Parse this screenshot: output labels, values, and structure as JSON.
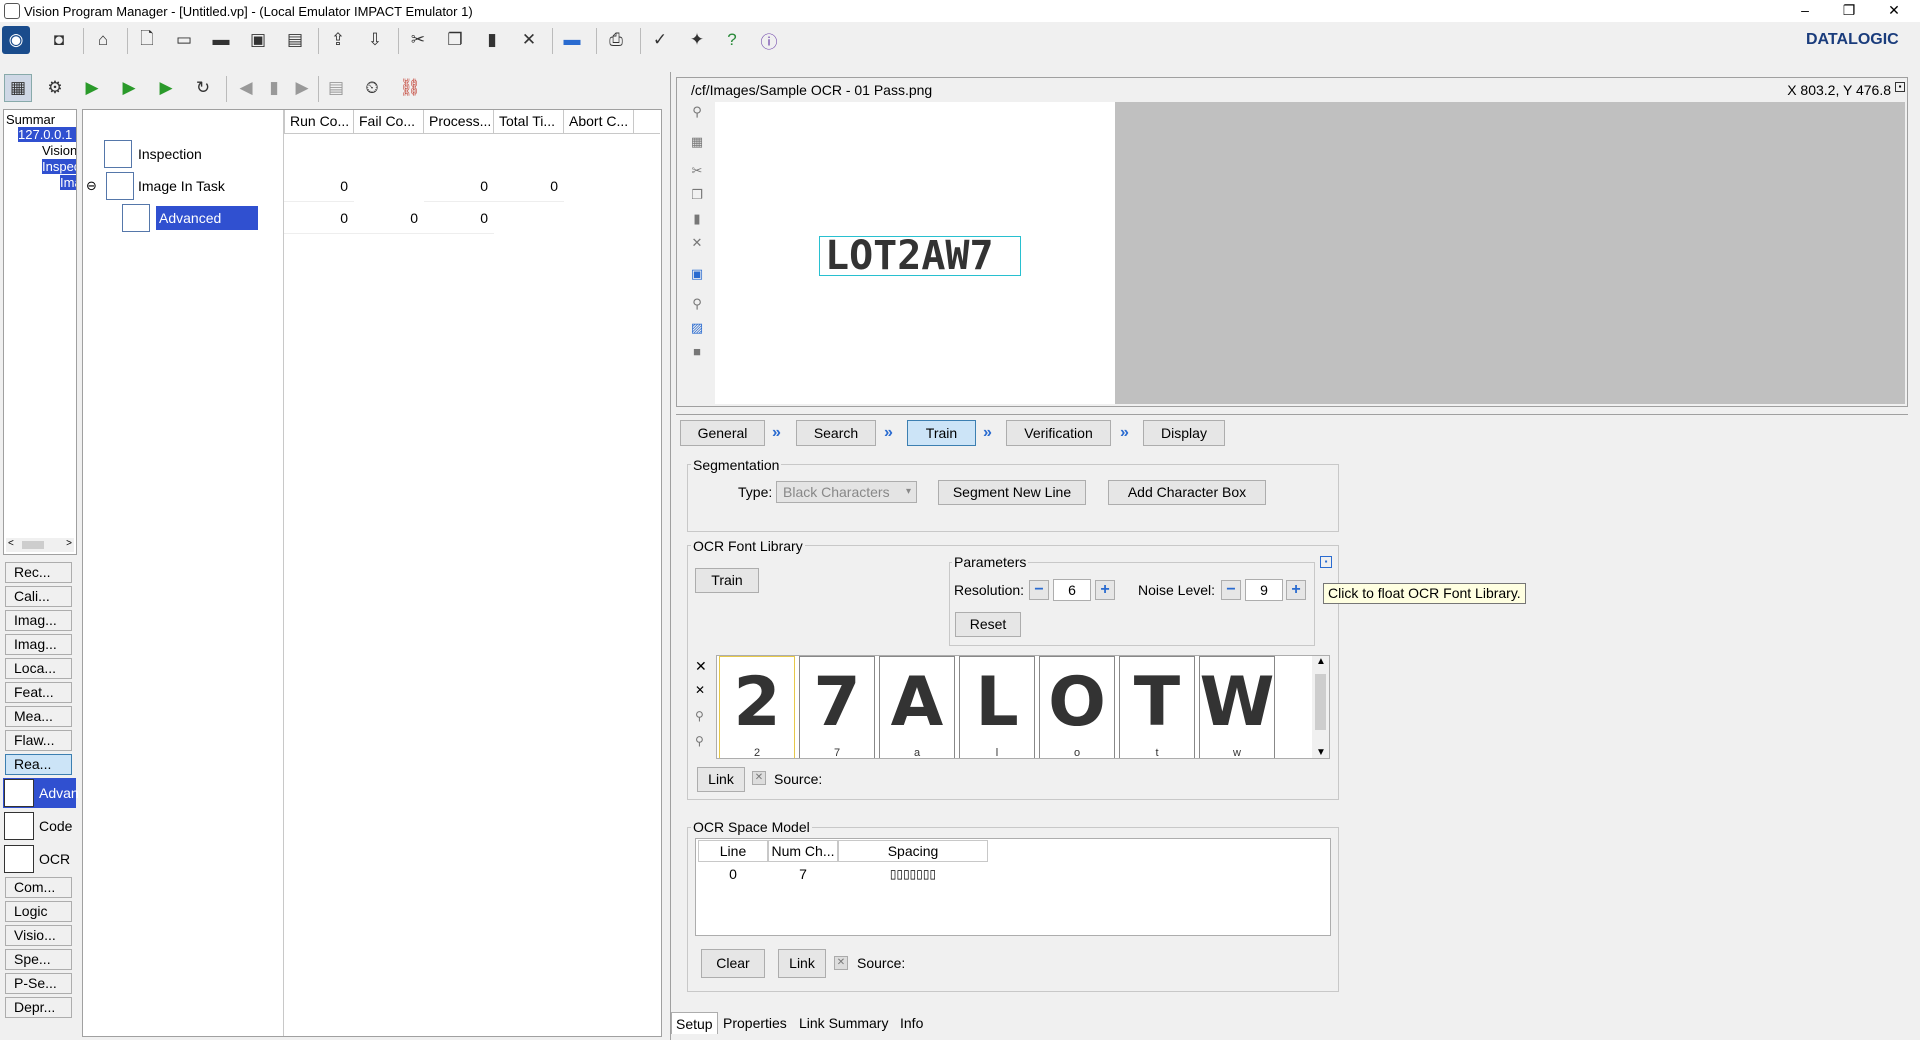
{
  "window": {
    "title": "Vision Program Manager - [Untitled.vp] - (Local Emulator IMPACT Emulator 1)",
    "minimize": "–",
    "restore": "❐",
    "close": "✕"
  },
  "brand": {
    "logo_text": "DATALOGIC"
  },
  "left_tree": {
    "items": [
      "Summar",
      "127.0.0.1",
      "Vision",
      "Inspec",
      "Ima"
    ]
  },
  "nav_buttons": [
    "Rec...",
    "Cali...",
    "Imag...",
    "Imag...",
    "Loca...",
    "Feat...",
    "Mea...",
    "Flaw...",
    "Rea..."
  ],
  "nav_big": [
    {
      "label": "Advan",
      "icon": "advanced-ocr-icon"
    },
    {
      "label": "Code",
      "icon": "code-reader-icon"
    },
    {
      "label": "OCR",
      "icon": "ocr-icon"
    }
  ],
  "nav_buttons2": [
    "Com...",
    "Logic",
    "Visio...",
    "Spe...",
    "P-Se...",
    "Depr..."
  ],
  "task_grid": {
    "columns": [
      "Run Co...",
      "Fail Co...",
      "Process...",
      "Total Ti...",
      "Abort C..."
    ],
    "rows": [
      {
        "name": "Inspection",
        "values": [
          "",
          "",
          "",
          "",
          ""
        ]
      },
      {
        "name": "Image In Task",
        "values": [
          "0",
          "",
          "0",
          "0",
          ""
        ]
      },
      {
        "name": "Advanced OCR",
        "values": [
          "0",
          "0",
          "0",
          "",
          ""
        ]
      }
    ]
  },
  "image_view": {
    "path": "/cf/Images/Sample OCR - 01 Pass.png",
    "coords": "X 803.2,  Y 476.8",
    "ocr_text": "LOT2AW7"
  },
  "steps": [
    "General",
    "Search",
    "Train",
    "Verification",
    "Display"
  ],
  "segmentation": {
    "title": "Segmentation",
    "type_label": "Type:",
    "type_value": "Black Characters",
    "segment_button": "Segment New Line",
    "add_box_button": "Add Character Box"
  },
  "font_library": {
    "title": "OCR Font Library",
    "train_button": "Train",
    "params_title": "Parameters",
    "resolution_label": "Resolution:",
    "resolution_value": "6",
    "noise_label": "Noise Level:",
    "noise_value": "9",
    "reset_button": "Reset",
    "tooltip": "Click to float OCR Font Library.",
    "glyphs": [
      {
        "char": "2",
        "label": "2"
      },
      {
        "char": "7",
        "label": "7"
      },
      {
        "char": "A",
        "label": "a"
      },
      {
        "char": "L",
        "label": "l"
      },
      {
        "char": "O",
        "label": "o"
      },
      {
        "char": "T",
        "label": "t"
      },
      {
        "char": "W",
        "label": "w"
      }
    ],
    "link_button": "Link",
    "source_label": "Source:"
  },
  "space_model": {
    "title": "OCR Space Model",
    "columns": [
      "Line",
      "Num Ch...",
      "Spacing"
    ],
    "rows": [
      [
        "0",
        "7",
        "▯▯▯▯▯▯▯"
      ]
    ],
    "clear_button": "Clear",
    "link_button": "Link",
    "source_label": "Source:"
  },
  "bottom_tabs": [
    "Setup",
    "Properties",
    "Link Summary",
    "Info"
  ]
}
